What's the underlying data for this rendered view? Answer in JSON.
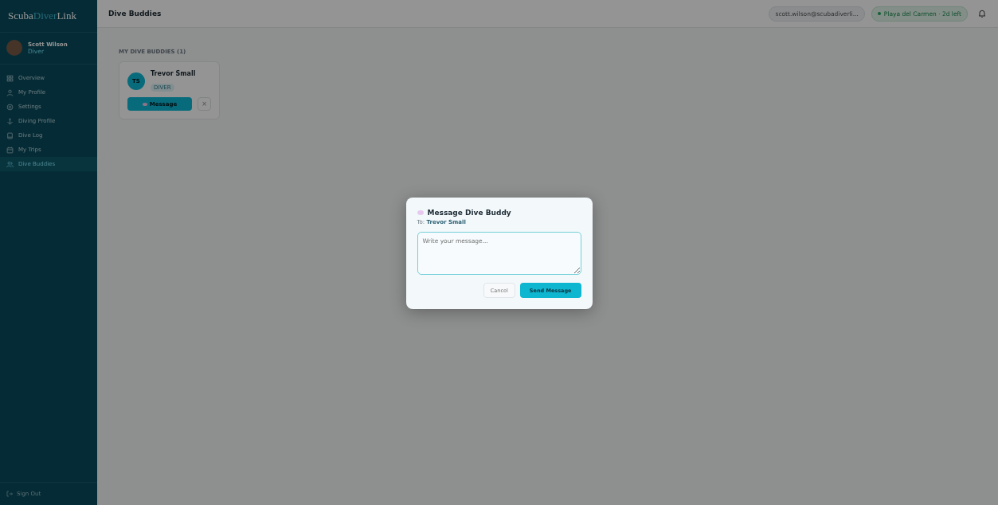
{
  "sidebar": {
    "logo": [
      {
        "text": "Scuba",
        "accent": false
      },
      {
        "text": "Diver",
        "accent": true
      },
      {
        "text": "Link",
        "accent": false
      }
    ],
    "user": {
      "name": "Scott Wilson",
      "role": "Diver"
    },
    "items": [
      {
        "label": "Overview",
        "kind": "grid",
        "selected": false
      },
      {
        "label": "My Profile",
        "kind": "user",
        "selected": false
      },
      {
        "label": "Settings",
        "kind": "gear",
        "selected": false
      },
      {
        "label": "Diving Profile",
        "kind": "anchor",
        "selected": false
      },
      {
        "label": "Dive Log",
        "kind": "book",
        "selected": false
      },
      {
        "label": "My Trips",
        "kind": "calendar",
        "selected": false
      },
      {
        "label": "Dive Buddies",
        "kind": "users",
        "selected": true
      }
    ],
    "sign_out": "Sign Out"
  },
  "header": {
    "title": "Dive Buddies",
    "email": "scott.wilson@scubadiverli...",
    "trip": "Playa del Carmen · 2d left"
  },
  "section_title": "MY DIVE BUDDIES (1)",
  "buddies": [
    {
      "initials": "TS",
      "name": "Trevor Small",
      "role": "DIVER",
      "message": "Message",
      "remove": "×"
    }
  ],
  "dialog": {
    "title": "Message Dive Buddy",
    "to_label": "To:",
    "to_name": "Trevor Small",
    "placeholder": "Write your message...",
    "cancel": "Cancel",
    "send": "Send Message"
  }
}
